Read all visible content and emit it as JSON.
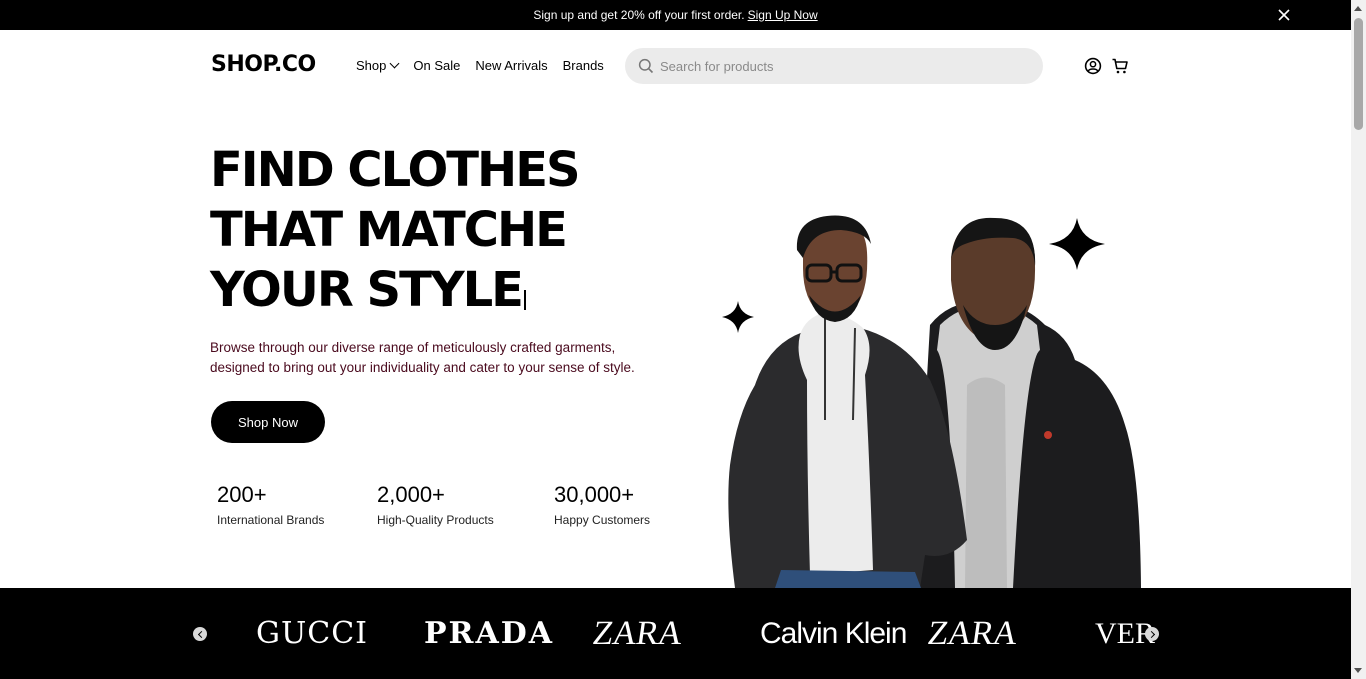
{
  "announcement": {
    "text": "Sign up and get 20% off your first order.",
    "link_label": "Sign Up Now"
  },
  "header": {
    "logo": "SHOP.CO",
    "nav": [
      "Shop",
      "On Sale",
      "New Arrivals",
      "Brands"
    ],
    "search_placeholder": "Search for products"
  },
  "hero": {
    "headline_lines": [
      "FIND CLOTHES",
      "THAT MATCHE",
      "YOUR STYLE"
    ],
    "description_line1": "Browse through our diverse range of meticulously crafted garments,",
    "description_line2": "designed to bring out your individuality and cater to your sense of style.",
    "cta_label": "Shop Now",
    "stats": [
      {
        "value": "200+",
        "label": "International Brands"
      },
      {
        "value": "2,000+",
        "label": "High-Quality Products"
      },
      {
        "value": "30,000+",
        "label": "Happy Customers"
      }
    ]
  },
  "brands": [
    "GUCCI",
    "PRADA",
    "ZARA",
    "Calvin Klein",
    "ZARA",
    "VER"
  ],
  "colors": {
    "topbar_bg": "#000000",
    "search_bg": "#ebebeb",
    "description_text": "#4a0a1e",
    "brand_strip_bg": "#000000"
  }
}
